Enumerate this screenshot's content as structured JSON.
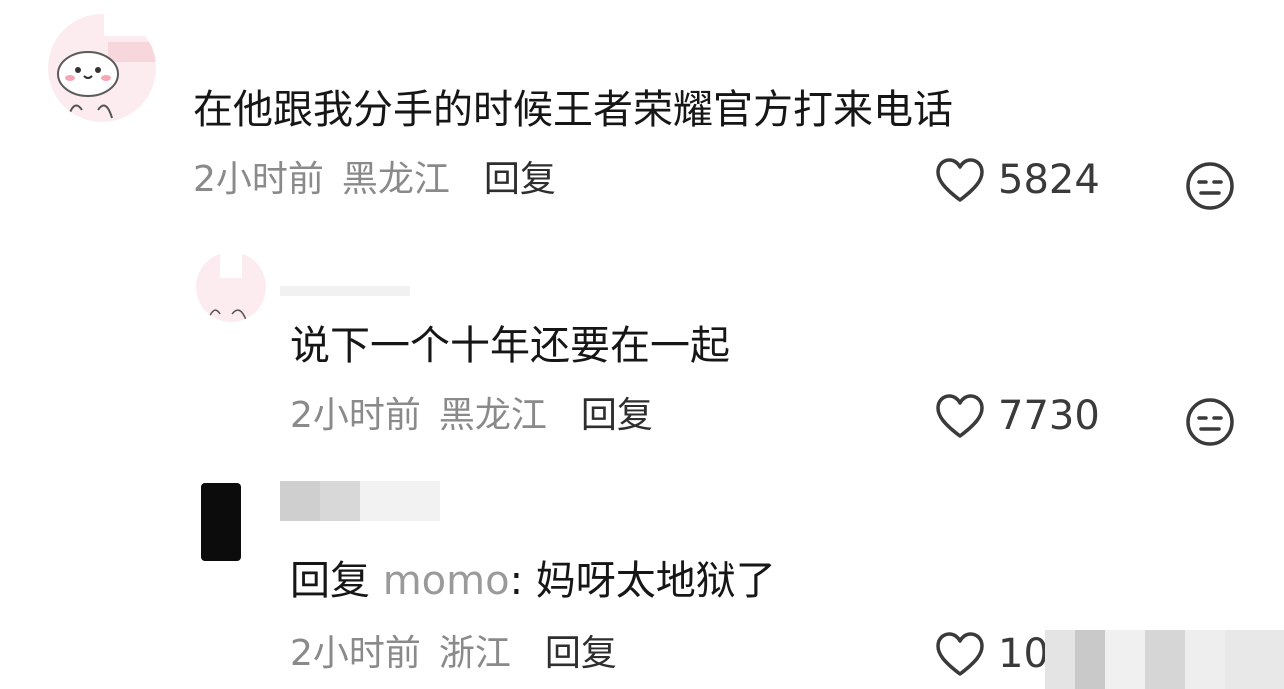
{
  "comments": [
    {
      "content": "在他跟我分手的时候王者荣耀官方打来电话",
      "time": "2小时前",
      "location": "黑龙江",
      "reply_label": "回复",
      "likes": "5824",
      "icon": "neutral-face-icon"
    },
    {
      "content": "说下一个十年还要在一起",
      "time": "2小时前",
      "location": "黑龙江",
      "reply_label": "回复",
      "likes": "7730",
      "icon": "neutral-face-icon"
    },
    {
      "reply_prefix": "回复",
      "mention": "momo",
      "content": ": 妈呀太地狱了",
      "time": "2小时前",
      "location": "浙江",
      "reply_label": "回复",
      "likes": "10",
      "icon": "heart-icon"
    }
  ],
  "colors": {
    "text_primary": "#161616",
    "text_meta": "#8a8a8a",
    "mention": "#9a9a9a",
    "icon_stroke": "#3a3a3a",
    "avatar_bg": "#fcecef"
  }
}
